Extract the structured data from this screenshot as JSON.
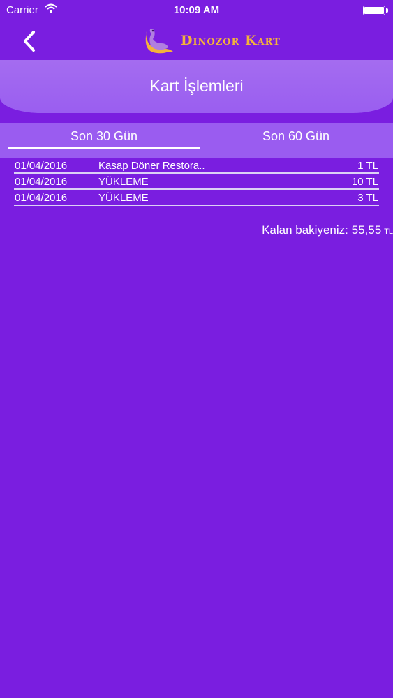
{
  "status_bar": {
    "carrier": "Carrier",
    "time": "10:09 AM"
  },
  "nav": {
    "back_icon": "chevron-left-icon",
    "logo_text": "Dinozor Kart",
    "logo_icon": "dinosaur-icon"
  },
  "page": {
    "title": "Kart İşlemleri"
  },
  "tabs": [
    {
      "label": "Son 30 Gün",
      "selected": true
    },
    {
      "label": "Son 60 Gün",
      "selected": false
    }
  ],
  "transactions": [
    {
      "date": "01/04/2016",
      "description": "Kasap Döner Restora..",
      "amount": "1 TL"
    },
    {
      "date": "01/04/2016",
      "description": "YÜKLEME",
      "amount": "10 TL"
    },
    {
      "date": "01/04/2016",
      "description": "YÜKLEME",
      "amount": "3 TL"
    }
  ],
  "balance": {
    "label": "Kalan bakiyeniz:",
    "value": "55,55",
    "currency": "TL"
  },
  "colors": {
    "background": "#7a1ee0",
    "header": "#a46cf0",
    "tab_bar": "#9a5cf0",
    "logo_text": "#f4b33a"
  }
}
